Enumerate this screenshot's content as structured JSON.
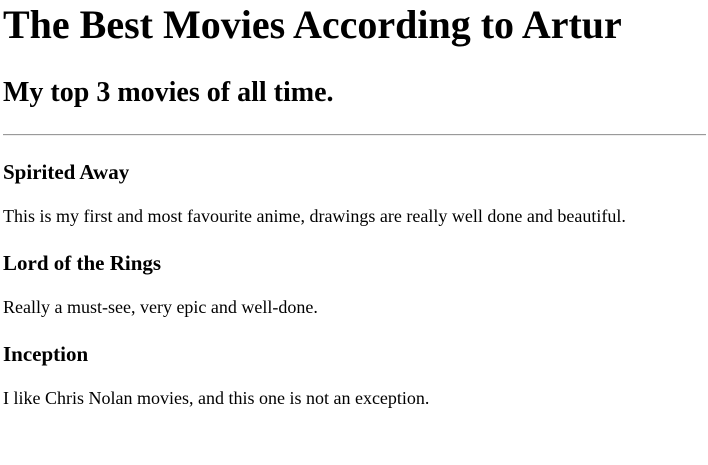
{
  "header": {
    "title": "The Best Movies According to Artur",
    "subtitle": "My top 3 movies of all time."
  },
  "movies": [
    {
      "title": "Spirited Away",
      "description": "This is my first and most favourite anime, drawings are really well done and beautiful."
    },
    {
      "title": "Lord of the Rings",
      "description": "Really a must-see, very epic and well-done."
    },
    {
      "title": "Inception",
      "description": "I like Chris Nolan movies, and this one is not an exception."
    }
  ]
}
